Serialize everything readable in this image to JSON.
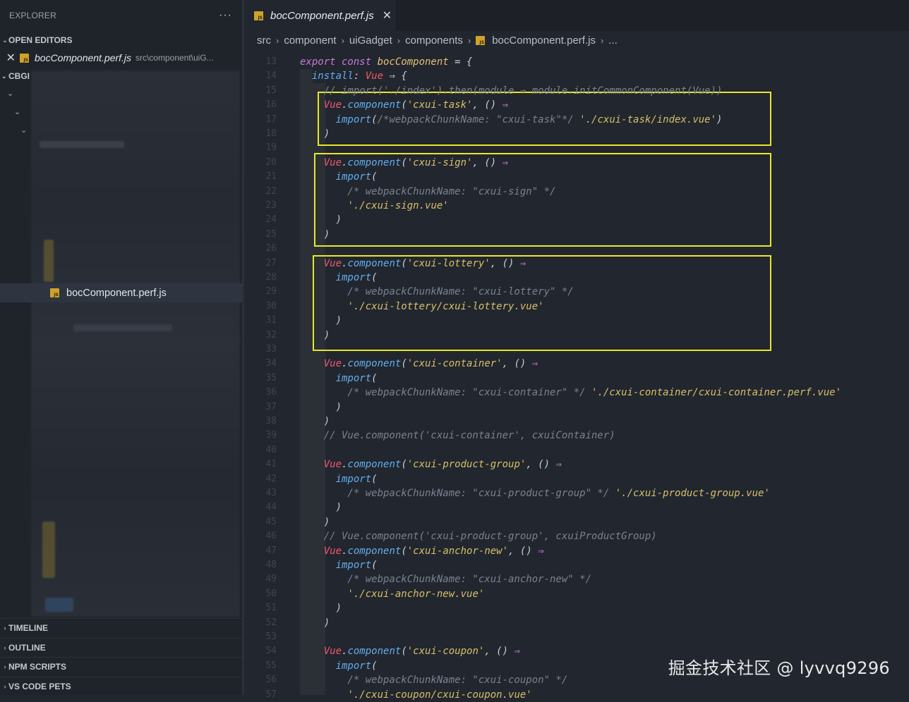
{
  "sidebar": {
    "title": "EXPLORER",
    "more": "···",
    "open_editors": {
      "label": "OPEN EDITORS",
      "file": {
        "name": "bocComponent.perf.js",
        "path": "src\\component\\uiG..."
      }
    },
    "workspace_label": "CBGI",
    "selected_file": "bocComponent.perf.js",
    "bottom_sections": [
      "TIMELINE",
      "OUTLINE",
      "NPM SCRIPTS",
      "VS CODE PETS"
    ]
  },
  "editor": {
    "tab": {
      "name": "bocComponent.perf.js",
      "close": "✕"
    },
    "breadcrumb": [
      "src",
      "component",
      "uiGadget",
      "components",
      "bocComponent.perf.js",
      "..."
    ],
    "code_lines": [
      {
        "n": "13",
        "t": [
          [
            "kw",
            "export const "
          ],
          [
            "var",
            "bocComponent"
          ],
          [
            "pn",
            " = {"
          ]
        ]
      },
      {
        "n": "14",
        "t": [
          [
            "pn",
            "  "
          ],
          [
            "fn",
            "install"
          ],
          [
            "pn",
            ": "
          ],
          [
            "vue",
            "Vue"
          ],
          [
            "pn",
            " ⇒ {"
          ]
        ]
      },
      {
        "n": "15",
        "t": [
          [
            "cm",
            "    // import('./index').then(module ⇒ module.initCommonComponent(Vue))"
          ]
        ]
      },
      {
        "n": "16",
        "t": [
          [
            "pn",
            "    "
          ],
          [
            "vue",
            "Vue"
          ],
          [
            "pn",
            "."
          ],
          [
            "fn",
            "component"
          ],
          [
            "pn",
            "("
          ],
          [
            "str",
            "'cxui-task'"
          ],
          [
            "pn",
            ", () "
          ],
          [
            "kw",
            "⇒"
          ]
        ]
      },
      {
        "n": "17",
        "t": [
          [
            "pn",
            "      "
          ],
          [
            "fn",
            "import"
          ],
          [
            "pn",
            "("
          ],
          [
            "cm",
            "/*webpackChunkName: \"cxui-task\"*/ "
          ],
          [
            "str",
            "'./cxui-task/index.vue'"
          ],
          [
            "pn",
            ")"
          ]
        ]
      },
      {
        "n": "18",
        "t": [
          [
            "pn",
            "    )"
          ]
        ]
      },
      {
        "n": "19",
        "t": [
          [
            "pn",
            ""
          ]
        ]
      },
      {
        "n": "20",
        "t": [
          [
            "pn",
            "    "
          ],
          [
            "vue",
            "Vue"
          ],
          [
            "pn",
            "."
          ],
          [
            "fn",
            "component"
          ],
          [
            "pn",
            "("
          ],
          [
            "str",
            "'cxui-sign'"
          ],
          [
            "pn",
            ", () "
          ],
          [
            "kw",
            "⇒"
          ]
        ]
      },
      {
        "n": "21",
        "t": [
          [
            "pn",
            "      "
          ],
          [
            "fn",
            "import"
          ],
          [
            "pn",
            "("
          ]
        ]
      },
      {
        "n": "22",
        "t": [
          [
            "cm",
            "        /* webpackChunkName: \"cxui-sign\" */"
          ]
        ]
      },
      {
        "n": "23",
        "t": [
          [
            "pn",
            "        "
          ],
          [
            "str",
            "'./cxui-sign.vue'"
          ]
        ]
      },
      {
        "n": "24",
        "t": [
          [
            "pn",
            "      )"
          ]
        ]
      },
      {
        "n": "25",
        "t": [
          [
            "pn",
            "    )"
          ]
        ]
      },
      {
        "n": "26",
        "t": [
          [
            "pn",
            ""
          ]
        ]
      },
      {
        "n": "27",
        "t": [
          [
            "pn",
            "    "
          ],
          [
            "vue",
            "Vue"
          ],
          [
            "pn",
            "."
          ],
          [
            "fn",
            "component"
          ],
          [
            "pn",
            "("
          ],
          [
            "str",
            "'cxui-lottery'"
          ],
          [
            "pn",
            ", () "
          ],
          [
            "kw",
            "⇒"
          ]
        ]
      },
      {
        "n": "28",
        "t": [
          [
            "pn",
            "      "
          ],
          [
            "fn",
            "import"
          ],
          [
            "pn",
            "("
          ]
        ]
      },
      {
        "n": "29",
        "t": [
          [
            "cm",
            "        /* webpackChunkName: \"cxui-lottery\" */"
          ]
        ]
      },
      {
        "n": "30",
        "t": [
          [
            "pn",
            "        "
          ],
          [
            "str",
            "'./cxui-lottery/cxui-lottery.vue'"
          ]
        ]
      },
      {
        "n": "31",
        "t": [
          [
            "pn",
            "      )"
          ]
        ]
      },
      {
        "n": "32",
        "t": [
          [
            "pn",
            "    )"
          ]
        ]
      },
      {
        "n": "33",
        "t": [
          [
            "pn",
            ""
          ]
        ]
      },
      {
        "n": "34",
        "t": [
          [
            "pn",
            "    "
          ],
          [
            "vue",
            "Vue"
          ],
          [
            "pn",
            "."
          ],
          [
            "fn",
            "component"
          ],
          [
            "pn",
            "("
          ],
          [
            "str",
            "'cxui-container'"
          ],
          [
            "pn",
            ", () "
          ],
          [
            "kw",
            "⇒"
          ]
        ]
      },
      {
        "n": "35",
        "t": [
          [
            "pn",
            "      "
          ],
          [
            "fn",
            "import"
          ],
          [
            "pn",
            "("
          ]
        ]
      },
      {
        "n": "36",
        "t": [
          [
            "cm",
            "        /* webpackChunkName: \"cxui-container\" */ "
          ],
          [
            "str",
            "'./cxui-container/cxui-container.perf.vue'"
          ]
        ]
      },
      {
        "n": "37",
        "t": [
          [
            "pn",
            "      )"
          ]
        ]
      },
      {
        "n": "38",
        "t": [
          [
            "pn",
            "    )"
          ]
        ]
      },
      {
        "n": "39",
        "t": [
          [
            "cm",
            "    // Vue.component('cxui-container', cxuiContainer)"
          ]
        ]
      },
      {
        "n": "40",
        "t": [
          [
            "pn",
            ""
          ]
        ]
      },
      {
        "n": "41",
        "t": [
          [
            "pn",
            "    "
          ],
          [
            "vue",
            "Vue"
          ],
          [
            "pn",
            "."
          ],
          [
            "fn",
            "component"
          ],
          [
            "pn",
            "("
          ],
          [
            "str",
            "'cxui-product-group'"
          ],
          [
            "pn",
            ", () "
          ],
          [
            "kw",
            "⇒"
          ]
        ]
      },
      {
        "n": "42",
        "t": [
          [
            "pn",
            "      "
          ],
          [
            "fn",
            "import"
          ],
          [
            "pn",
            "("
          ]
        ]
      },
      {
        "n": "43",
        "t": [
          [
            "cm",
            "        /* webpackChunkName: \"cxui-product-group\" */ "
          ],
          [
            "str",
            "'./cxui-product-group.vue'"
          ]
        ]
      },
      {
        "n": "44",
        "t": [
          [
            "pn",
            "      )"
          ]
        ]
      },
      {
        "n": "45",
        "t": [
          [
            "pn",
            "    )"
          ]
        ]
      },
      {
        "n": "46",
        "t": [
          [
            "cm",
            "    // Vue.component('cxui-product-group', cxuiProductGroup)"
          ]
        ]
      },
      {
        "n": "47",
        "t": [
          [
            "pn",
            "    "
          ],
          [
            "vue",
            "Vue"
          ],
          [
            "pn",
            "."
          ],
          [
            "fn",
            "component"
          ],
          [
            "pn",
            "("
          ],
          [
            "str",
            "'cxui-anchor-new'"
          ],
          [
            "pn",
            ", () "
          ],
          [
            "kw",
            "⇒"
          ]
        ]
      },
      {
        "n": "48",
        "t": [
          [
            "pn",
            "      "
          ],
          [
            "fn",
            "import"
          ],
          [
            "pn",
            "("
          ]
        ]
      },
      {
        "n": "49",
        "t": [
          [
            "cm",
            "        /* webpackChunkName: \"cxui-anchor-new\" */"
          ]
        ]
      },
      {
        "n": "50",
        "t": [
          [
            "pn",
            "        "
          ],
          [
            "str",
            "'./cxui-anchor-new.vue'"
          ]
        ]
      },
      {
        "n": "51",
        "t": [
          [
            "pn",
            "      )"
          ]
        ]
      },
      {
        "n": "52",
        "t": [
          [
            "pn",
            "    )"
          ]
        ]
      },
      {
        "n": "53",
        "t": [
          [
            "pn",
            ""
          ]
        ]
      },
      {
        "n": "54",
        "t": [
          [
            "pn",
            "    "
          ],
          [
            "vue",
            "Vue"
          ],
          [
            "pn",
            "."
          ],
          [
            "fn",
            "component"
          ],
          [
            "pn",
            "("
          ],
          [
            "str",
            "'cxui-coupon'"
          ],
          [
            "pn",
            ", () "
          ],
          [
            "kw",
            "⇒"
          ]
        ]
      },
      {
        "n": "55",
        "t": [
          [
            "pn",
            "      "
          ],
          [
            "fn",
            "import"
          ],
          [
            "pn",
            "("
          ]
        ]
      },
      {
        "n": "56",
        "t": [
          [
            "cm",
            "        /* webpackChunkName: \"cxui-coupon\" */"
          ]
        ]
      },
      {
        "n": "57",
        "t": [
          [
            "pn",
            "        "
          ],
          [
            "str",
            "'./cxui-coupon/cxui-coupon.vue'"
          ]
        ]
      }
    ]
  },
  "watermark": "掘金技术社区 @ lyvvq9296",
  "colors": {
    "highlight_box": "#e9e62a",
    "accent": "#cfa22a"
  }
}
